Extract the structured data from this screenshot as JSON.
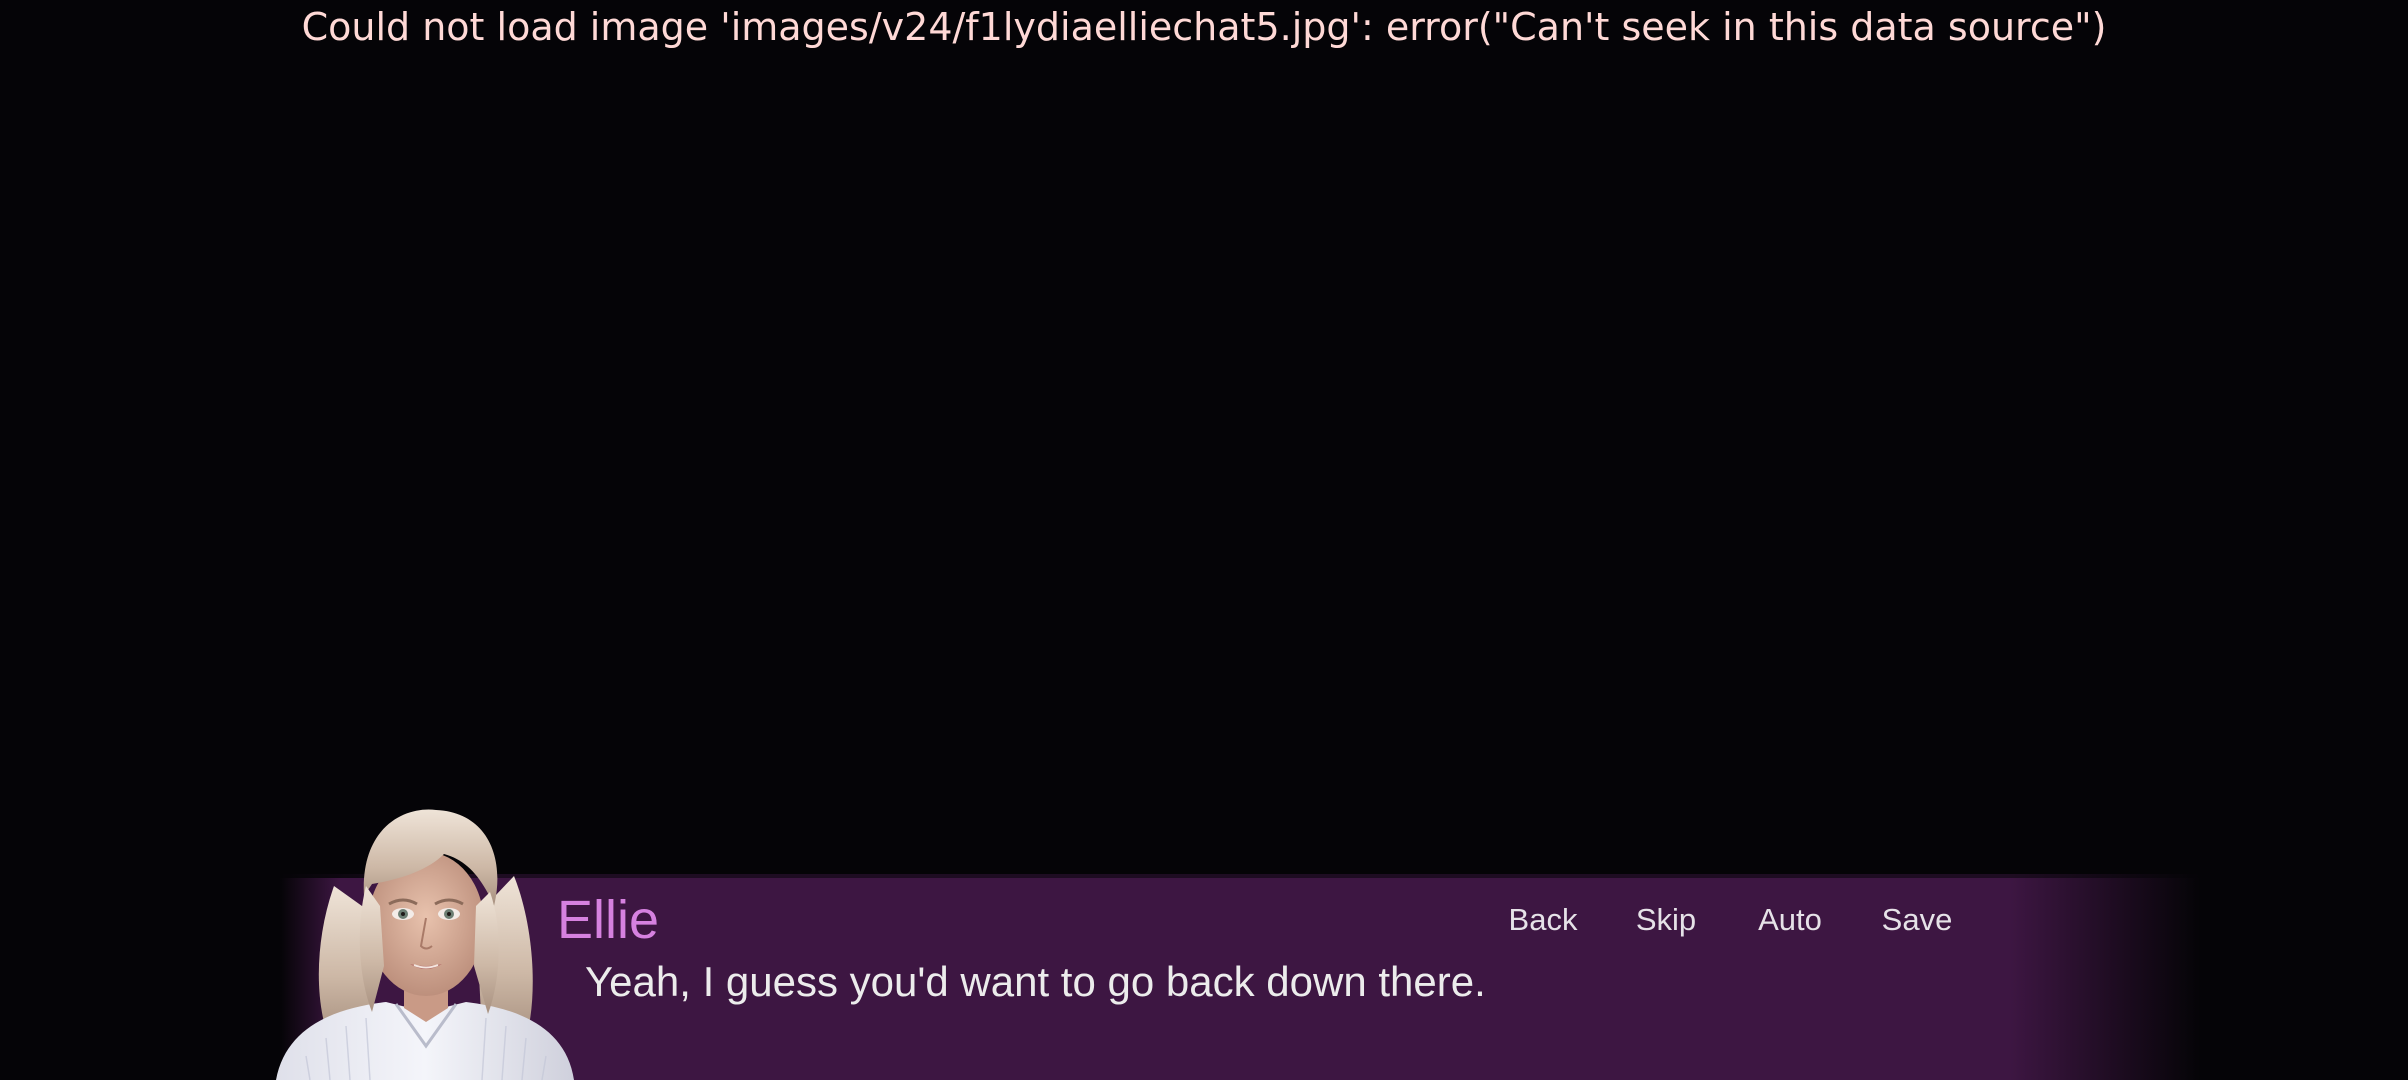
{
  "error": {
    "message": "Could not load image 'images/v24/f1lydiaelliechat5.jpg': error(\"Can't seek in this data source\")"
  },
  "dialogue": {
    "speaker": "Ellie",
    "text": "Yeah, I guess you'd want to go back down there."
  },
  "quick_menu": {
    "back": "Back",
    "skip": "Skip",
    "auto": "Auto",
    "save": "Save"
  },
  "portrait": {
    "character": "Ellie",
    "icon": "character-portrait"
  },
  "colors": {
    "background": "#050407",
    "textbox": "#3d1642",
    "speaker_name": "#d681e0",
    "dialogue_text": "#ececec",
    "error_text": "#ffd9d6",
    "menu_text": "#e6e2e8"
  }
}
